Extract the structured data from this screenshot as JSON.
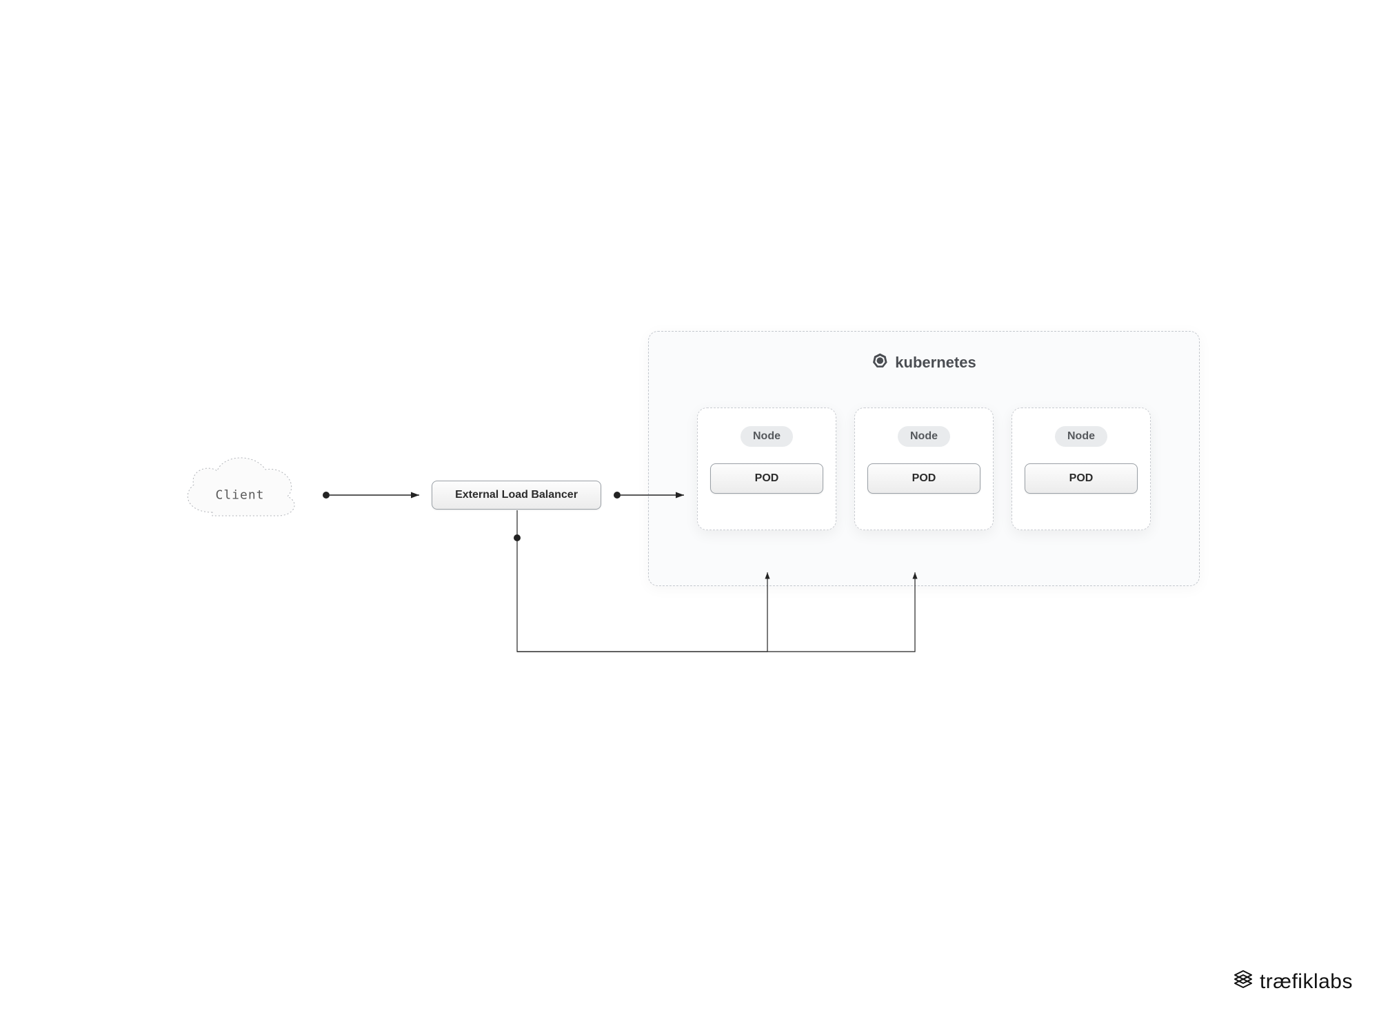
{
  "client": {
    "label": "Client"
  },
  "loadBalancer": {
    "label": "External Load Balancer"
  },
  "cluster": {
    "title": "kubernetes",
    "nodes": [
      {
        "badge": "Node",
        "pod": "POD"
      },
      {
        "badge": "Node",
        "pod": "POD"
      },
      {
        "badge": "Node",
        "pod": "POD"
      }
    ]
  },
  "brand": {
    "part1": "træfik",
    "part2": "labs"
  }
}
